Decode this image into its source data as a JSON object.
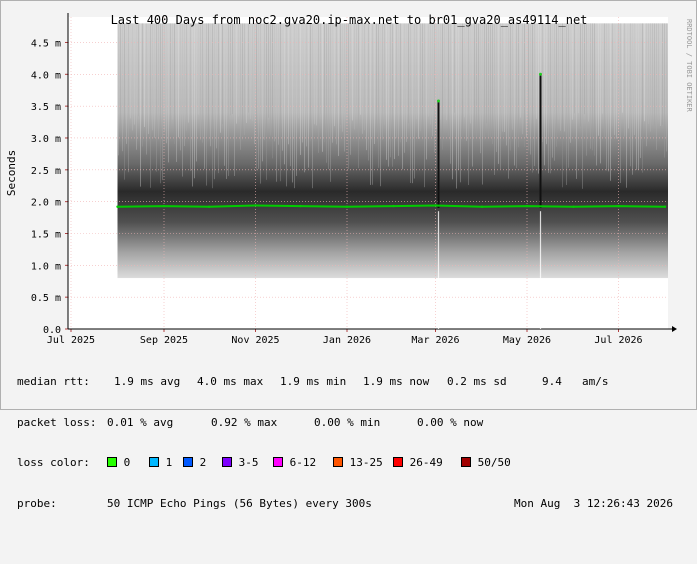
{
  "chart_data": {
    "type": "line",
    "title": "Last 400 Days from noc2.gva20.ip-max.net to br01_gva20_as49114_net",
    "ylabel": "Seconds",
    "watermark": "RRDTOOL / TOBI OETIKER",
    "y_ticks": [
      "0.0",
      "0.5 m",
      "1.0 m",
      "1.5 m",
      "2.0 m",
      "2.5 m",
      "3.0 m",
      "3.5 m",
      "4.0 m",
      "4.5 m"
    ],
    "ylim": [
      0,
      4.9
    ],
    "x_ticks": [
      "Jul 2025",
      "Sep 2025",
      "Nov 2025",
      "Jan 2026",
      "Mar 2026",
      "May 2026",
      "Jul 2026"
    ],
    "x": [
      "2025-07-01",
      "2025-08-01",
      "2025-09-01",
      "2025-10-01",
      "2025-11-01",
      "2025-12-01",
      "2026-01-01",
      "2026-02-01",
      "2026-03-01",
      "2026-04-01",
      "2026-05-01",
      "2026-06-01",
      "2026-07-01",
      "2026-08-01"
    ],
    "series": [
      {
        "name": "median rtt",
        "color": "#00cc00",
        "values": [
          null,
          1.92,
          1.93,
          1.92,
          1.94,
          1.93,
          1.92,
          1.93,
          1.94,
          1.92,
          1.93,
          1.92,
          1.93,
          1.92
        ]
      }
    ],
    "spikes": [
      {
        "x": "2026-03-03",
        "y": 3.58
      },
      {
        "x": "2026-05-10",
        "y": 4.0
      }
    ],
    "smoke_range": {
      "min": 0.8,
      "max": 4.8
    }
  },
  "stats": {
    "median_rtt": {
      "label": "median rtt:",
      "avg": "1.9 ms avg",
      "max": "4.0 ms max",
      "min": "1.9 ms min",
      "now": "1.9 ms now",
      "sd": "0.2 ms sd",
      "am": "9.4",
      "am_unit": "am/s"
    },
    "packet_loss": {
      "label": "packet loss:",
      "avg": "0.01 % avg",
      "max": "0.92 % max",
      "min": "0.00 % min",
      "now": "0.00 % now"
    },
    "loss_color": {
      "label": "loss color:",
      "items": [
        {
          "label": "0",
          "color": "#26ff00"
        },
        {
          "label": "1",
          "color": "#00b8ff"
        },
        {
          "label": "2",
          "color": "#0059ff"
        },
        {
          "label": "3-5",
          "color": "#7e00ff"
        },
        {
          "label": "6-12",
          "color": "#ff00ff"
        },
        {
          "label": "13-25",
          "color": "#ff5500"
        },
        {
          "label": "26-49",
          "color": "#ff0000"
        },
        {
          "label": "50/50",
          "color": "#a10000"
        }
      ]
    },
    "probe": {
      "label": "probe:",
      "text": "50 ICMP Echo Pings (56 Bytes) every 300s",
      "timestamp": "Mon Aug  3 12:26:43 2026"
    }
  }
}
